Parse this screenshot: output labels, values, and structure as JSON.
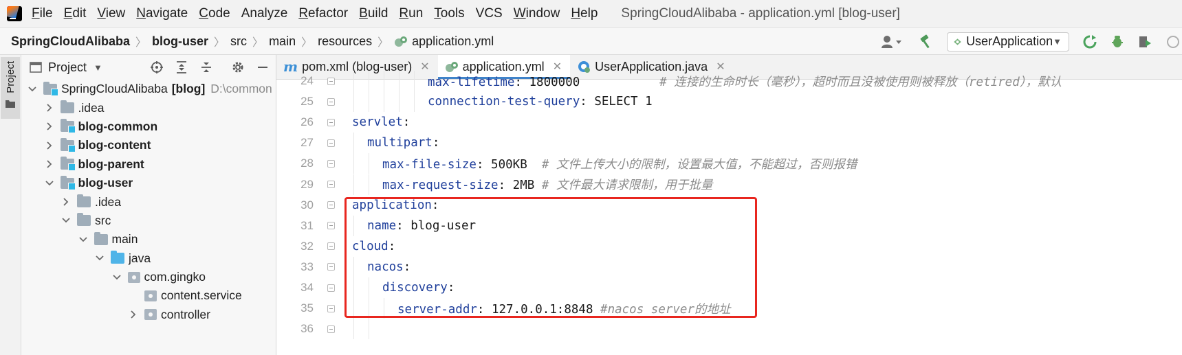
{
  "menubar": {
    "items": [
      {
        "mn": "F",
        "rest": "ile"
      },
      {
        "mn": "E",
        "rest": "dit"
      },
      {
        "mn": "V",
        "rest": "iew"
      },
      {
        "mn": "N",
        "rest": "avigate"
      },
      {
        "mn": "C",
        "rest": "ode"
      },
      {
        "mn": "",
        "rest": "Analyze"
      },
      {
        "mn": "R",
        "rest": "efactor"
      },
      {
        "mn": "B",
        "rest": "uild"
      },
      {
        "mn": "R",
        "rest": "un"
      },
      {
        "mn": "T",
        "rest": "ools"
      },
      {
        "mn": "",
        "rest": "VCS"
      },
      {
        "mn": "W",
        "rest": "indow"
      },
      {
        "mn": "H",
        "rest": "elp"
      }
    ],
    "window_title": "SpringCloudAlibaba - application.yml [blog-user]"
  },
  "navbar": {
    "crumbs": [
      "SpringCloudAlibaba",
      "blog-user",
      "src",
      "main",
      "resources",
      "application.yml"
    ],
    "run_config": "UserApplication"
  },
  "left_stripe": {
    "project_label": "Project"
  },
  "project": {
    "title": "Project",
    "tree": [
      {
        "label": "SpringCloudAlibaba",
        "bold_suffix": "[blog]",
        "dim": "D:\\common",
        "level": 0,
        "expanded": true,
        "icon": "module-folder"
      },
      {
        "label": ".idea",
        "level": 1,
        "expanded": false,
        "icon": "folder"
      },
      {
        "label": "blog-common",
        "level": 1,
        "expanded": false,
        "icon": "module-folder",
        "bold": true
      },
      {
        "label": "blog-content",
        "level": 1,
        "expanded": false,
        "icon": "module-folder",
        "bold": true
      },
      {
        "label": "blog-parent",
        "level": 1,
        "expanded": false,
        "icon": "module-folder",
        "bold": true
      },
      {
        "label": "blog-user",
        "level": 1,
        "expanded": true,
        "icon": "module-folder",
        "bold": true
      },
      {
        "label": ".idea",
        "level": 2,
        "expanded": false,
        "icon": "folder"
      },
      {
        "label": "src",
        "level": 2,
        "expanded": true,
        "icon": "folder"
      },
      {
        "label": "main",
        "level": 3,
        "expanded": true,
        "icon": "folder"
      },
      {
        "label": "java",
        "level": 4,
        "expanded": true,
        "icon": "java-folder"
      },
      {
        "label": "com.gingko",
        "level": 5,
        "expanded": true,
        "icon": "package"
      },
      {
        "label": "content.service",
        "level": 6,
        "expanded": null,
        "icon": "package"
      },
      {
        "label": "controller",
        "level": 6,
        "expanded": false,
        "icon": "package"
      }
    ]
  },
  "editor": {
    "tabs": [
      {
        "label": "pom.xml (blog-user)",
        "icon": "maven-icon",
        "active": false
      },
      {
        "label": "application.yml",
        "icon": "yaml-spring-icon",
        "active": true
      },
      {
        "label": "UserApplication.java",
        "icon": "spring-class-icon",
        "active": false
      }
    ],
    "lines": [
      {
        "num": "24",
        "indent": 5,
        "key": "max-lifetime",
        "value": " 1800000",
        "comment": "           # 连接的生命时长（毫秒），超时而且没被使用则被释放（retired），默认"
      },
      {
        "num": "25",
        "indent": 5,
        "key": "connection-test-query",
        "value": " SELECT 1",
        "comment": ""
      },
      {
        "num": "26",
        "indent": 0,
        "key": "servlet",
        "value": "",
        "comment": ""
      },
      {
        "num": "27",
        "indent": 1,
        "key": "multipart",
        "value": "",
        "comment": ""
      },
      {
        "num": "28",
        "indent": 2,
        "key": "max-file-size",
        "value": " 500KB  ",
        "comment": "# 文件上传大小的限制，设置最大值，不能超过，否则报错"
      },
      {
        "num": "29",
        "indent": 2,
        "key": "max-request-size",
        "value": " 2MB ",
        "comment": "# 文件最大请求限制，用于批量"
      },
      {
        "num": "30",
        "indent": 0,
        "key": "application",
        "value": "",
        "comment": ""
      },
      {
        "num": "31",
        "indent": 1,
        "key": "name",
        "value": " blog-user",
        "comment": ""
      },
      {
        "num": "32",
        "indent": 0,
        "key": "cloud",
        "value": "",
        "comment": ""
      },
      {
        "num": "33",
        "indent": 1,
        "key": "nacos",
        "value": "",
        "comment": ""
      },
      {
        "num": "34",
        "indent": 2,
        "key": "discovery",
        "value": "",
        "comment": ""
      },
      {
        "num": "35",
        "indent": 3,
        "key": "server-addr",
        "value": " 127.0.0.1:8848 ",
        "comment": "#nacos server的地址"
      },
      {
        "num": "36",
        "indent": 2,
        "key": "",
        "value": "",
        "comment": ""
      }
    ]
  },
  "colors": {
    "accent_tab_underline": "#4083c9",
    "highlight_box": "#e8261f",
    "yaml_key": "#1f3f9b",
    "comment": "#8c8c8c"
  }
}
